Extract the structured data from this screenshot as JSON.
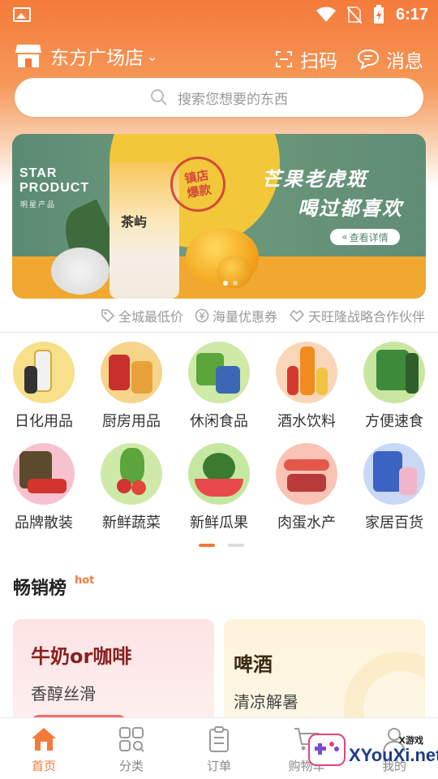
{
  "status_bar": {
    "time": "6:17"
  },
  "header": {
    "store_name": "东方广场店",
    "scan_label": "扫码",
    "message_label": "消息"
  },
  "search": {
    "placeholder": "搜索您想要的东西"
  },
  "banner": {
    "star_line1": "STAR",
    "star_line2": "PRODUCT",
    "star_line3": "明星产品",
    "cup_label": "茶屿",
    "stamp_text": "镇店爆款",
    "title_line1": "芒果老虎斑",
    "title_line2": "喝过都喜欢",
    "detail_button": "查看详情"
  },
  "guarantees": [
    {
      "label": "全城最低价",
      "icon": "price-tag-icon"
    },
    {
      "label": "海量优惠券",
      "icon": "yen-coupon-icon"
    },
    {
      "label": "天旺隆战略合作伙伴",
      "icon": "handshake-icon"
    }
  ],
  "categories": [
    {
      "label": "日化用品",
      "icon": "daily-chemicals-icon",
      "bg": "#f8e08a"
    },
    {
      "label": "厨房用品",
      "icon": "kitchen-icon",
      "bg": "#f6d48a"
    },
    {
      "label": "休闲食品",
      "icon": "snacks-icon",
      "bg": "#cfe9a6"
    },
    {
      "label": "酒水饮料",
      "icon": "drinks-icon",
      "bg": "#fad6b8"
    },
    {
      "label": "方便速食",
      "icon": "instant-food-icon",
      "bg": "#c8e6a0"
    },
    {
      "label": "品牌散装",
      "icon": "bulk-brand-icon",
      "bg": "#f7c2cf"
    },
    {
      "label": "新鲜蔬菜",
      "icon": "vegetables-icon",
      "bg": "#cfeaa8"
    },
    {
      "label": "新鲜瓜果",
      "icon": "fruit-icon",
      "bg": "#c5e8a0"
    },
    {
      "label": "肉蛋水产",
      "icon": "meat-seafood-icon",
      "bg": "#fbc3b4"
    },
    {
      "label": "家居百货",
      "icon": "household-icon",
      "bg": "#c9d8f4"
    }
  ],
  "bestseller": {
    "title": "畅销榜",
    "tag": "hot",
    "cards": [
      {
        "title": "牛奶or咖啡",
        "subtitle": "香醇丝滑"
      },
      {
        "title": "啤酒",
        "subtitle": "清凉解暑"
      }
    ]
  },
  "bottom_nav": [
    {
      "label": "首页",
      "icon": "home-icon",
      "active": true
    },
    {
      "label": "分类",
      "icon": "category-grid-icon",
      "active": false
    },
    {
      "label": "订单",
      "icon": "order-clipboard-icon",
      "active": false
    },
    {
      "label": "购物车",
      "icon": "shopping-cart-icon",
      "active": false
    },
    {
      "label": "我的",
      "icon": "profile-icon",
      "active": false
    }
  ],
  "watermark": {
    "text": "XYouXi.net",
    "small": "X游戏"
  },
  "colors": {
    "accent": "#f47a3a",
    "banner_green": "#5a8a72"
  }
}
